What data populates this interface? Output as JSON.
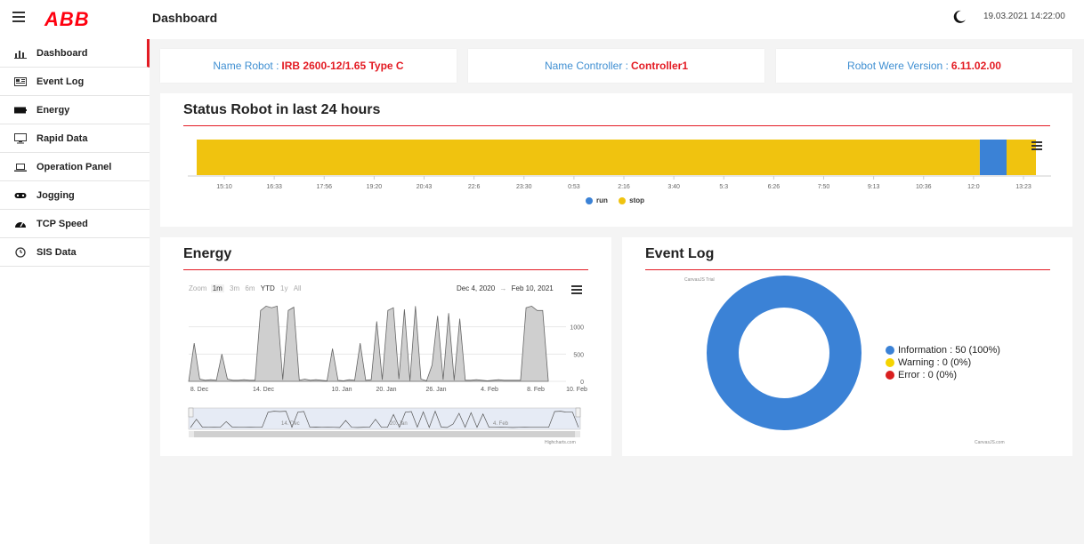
{
  "header": {
    "logo": "ABB",
    "page_title": "Dashboard",
    "datetime": "19.03.2021 14:22:00"
  },
  "sidebar": {
    "items": [
      {
        "label": "Dashboard",
        "icon": "bar-chart-icon"
      },
      {
        "label": "Event Log",
        "icon": "log-icon"
      },
      {
        "label": "Energy",
        "icon": "battery-icon"
      },
      {
        "label": "Rapid Data",
        "icon": "monitor-icon"
      },
      {
        "label": "Operation Panel",
        "icon": "laptop-icon"
      },
      {
        "label": "Jogging",
        "icon": "gamepad-icon"
      },
      {
        "label": "TCP Speed",
        "icon": "speedometer-icon"
      },
      {
        "label": "SIS Data",
        "icon": "clock-icon"
      }
    ]
  },
  "info": {
    "robot_label": "Name Robot :",
    "robot_value": "IRB 2600-12/1.65 Type C",
    "controller_label": "Name Controller :",
    "controller_value": "Controller1",
    "version_label": "Robot Were Version :",
    "version_value": "6.11.02.00"
  },
  "status_panel": {
    "title": "Status Robot in last 24 hours",
    "legend_run": "run",
    "legend_stop": "stop"
  },
  "energy_panel": {
    "title": "Energy",
    "zoom_label": "Zoom",
    "zoom_options": [
      "1m",
      "3m",
      "6m",
      "YTD",
      "1y",
      "All"
    ],
    "date_from": "Dec 4, 2020",
    "date_sep": "→",
    "date_to": "Feb 10, 2021",
    "credit": "Highcharts.com"
  },
  "event_panel": {
    "title": "Event Log",
    "trial_text": "CanvasJS Trial",
    "credit": "CanvasJS.com",
    "legend": [
      {
        "label": "Information : 50 (100%)",
        "color": "#3b82d6"
      },
      {
        "label": "Warning : 0 (0%)",
        "color": "#f5d400"
      },
      {
        "label": "Error : 0 (0%)",
        "color": "#d91f1f"
      }
    ]
  },
  "colors": {
    "accent": "#e31b23",
    "run": "#3b82d6",
    "stop": "#f0c30f",
    "info_label": "#3f8fd2"
  },
  "chart_data": [
    {
      "type": "bar",
      "title": "Status Robot in last 24 hours",
      "x_ticks": [
        "15:10",
        "16:33",
        "17:56",
        "19:20",
        "20:43",
        "22:6",
        "23:30",
        "0:53",
        "2:16",
        "3:40",
        "5:3",
        "6:26",
        "7:50",
        "9:13",
        "10:36",
        "12:0",
        "13:23"
      ],
      "series": [
        {
          "name": "run",
          "segments": [
            [
              0.933,
              0.965
            ]
          ]
        },
        {
          "name": "stop",
          "segments": [
            [
              0,
              0.933
            ],
            [
              0.965,
              1.0
            ]
          ]
        }
      ],
      "legend": "bottom-center"
    },
    {
      "type": "area",
      "title": "Energy",
      "x_ticks": [
        "8. Dec",
        "14. Dec",
        "10. Jan",
        "20. Jan",
        "26. Jan",
        "4. Feb",
        "8. Feb",
        "10. Feb"
      ],
      "y_ticks": [
        0,
        500,
        1000
      ],
      "ylim": [
        0,
        1500
      ],
      "x_range": [
        "Dec 4, 2020",
        "Feb 10, 2021"
      ],
      "values": [
        0,
        700,
        40,
        20,
        30,
        20,
        500,
        40,
        20,
        20,
        30,
        20,
        20,
        1300,
        1380,
        1350,
        1380,
        30,
        1300,
        1360,
        20,
        40,
        20,
        30,
        20,
        10,
        600,
        20,
        10,
        30,
        20,
        700,
        20,
        30,
        1100,
        30,
        1300,
        1350,
        40,
        1320,
        10,
        1380,
        40,
        10,
        300,
        1200,
        30,
        1250,
        20,
        1150,
        20,
        20,
        30,
        20,
        10,
        20,
        30,
        20,
        20,
        20,
        20,
        1350,
        1380,
        1300,
        1300,
        20
      ],
      "navigator_ticks": [
        "14. Dec",
        "20. Jan",
        "4. Feb"
      ]
    },
    {
      "type": "pie",
      "title": "Event Log",
      "categories": [
        "Information",
        "Warning",
        "Error"
      ],
      "values": [
        50,
        0,
        0
      ],
      "legend": "right"
    }
  ]
}
